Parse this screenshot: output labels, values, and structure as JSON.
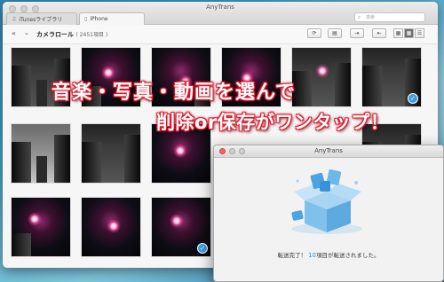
{
  "window": {
    "title": "AnyTrans",
    "tabs": [
      {
        "label": "iTunesライブラリ",
        "icon": "music-note-icon"
      },
      {
        "label": "iPhone",
        "icon": "iphone-icon"
      }
    ],
    "search_placeholder": "検索"
  },
  "toolbar": {
    "album_title": "カメラロール",
    "album_count": "( 2451項目 )",
    "buttons": [
      "refresh-icon",
      "trash-icon",
      "import-icon",
      "export-icon"
    ],
    "views": [
      "grid-large-icon",
      "grid-small-icon",
      "list-icon"
    ]
  },
  "overlay": {
    "line1": "音楽・写真・動画を選んで",
    "line2": "削除or保存がワンタップ！"
  },
  "dialog": {
    "title": "AnyTrans",
    "message_prefix": "転送完了！",
    "count": "10",
    "message_suffix": "項目が転送されました。"
  },
  "colors": {
    "accent": "#3a9ce0",
    "headline_outline": "#e0182a"
  }
}
